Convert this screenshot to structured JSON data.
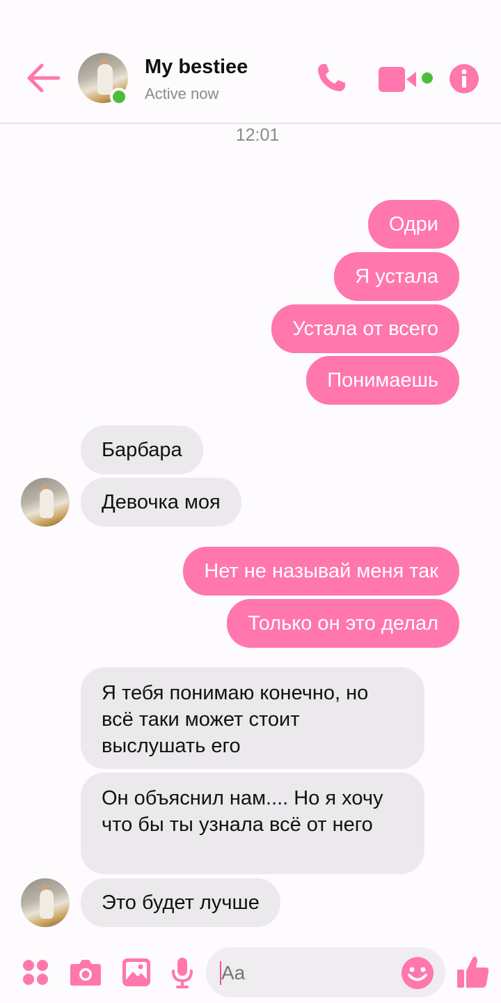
{
  "colors": {
    "accent": "#ff77ac",
    "online": "#4cbd3b",
    "incoming_bubble": "#ebe9ec"
  },
  "header": {
    "contact_name": "My bestiee",
    "status": "Active now",
    "icons": [
      "back-arrow-icon",
      "phone-icon",
      "video-camera-icon",
      "info-icon"
    ]
  },
  "conversation": {
    "timestamp": "12:01",
    "messages": [
      {
        "from": "me",
        "text": "Одри"
      },
      {
        "from": "me",
        "text": "Я устала"
      },
      {
        "from": "me",
        "text": "Устала от всего"
      },
      {
        "from": "me",
        "text": "Понимаешь"
      },
      {
        "from": "contact",
        "text": "Барбара"
      },
      {
        "from": "contact",
        "text": "Девочка моя"
      },
      {
        "from": "me",
        "text": "Нет не называй меня так"
      },
      {
        "from": "me",
        "text": "Только он это делал"
      },
      {
        "from": "contact",
        "text": "Я тебя понимаю конечно, но всё таки может стоит выслушать его"
      },
      {
        "from": "contact",
        "text": "Он объяснил нам.... Но я хочу что бы ты узнала всё от него"
      },
      {
        "from": "contact",
        "text": "Это будет лучше"
      }
    ]
  },
  "composer": {
    "placeholder": "Aa",
    "icons": [
      "apps-grid-icon",
      "camera-icon",
      "gallery-icon",
      "microphone-icon",
      "emoji-icon",
      "thumbs-up-icon"
    ]
  }
}
